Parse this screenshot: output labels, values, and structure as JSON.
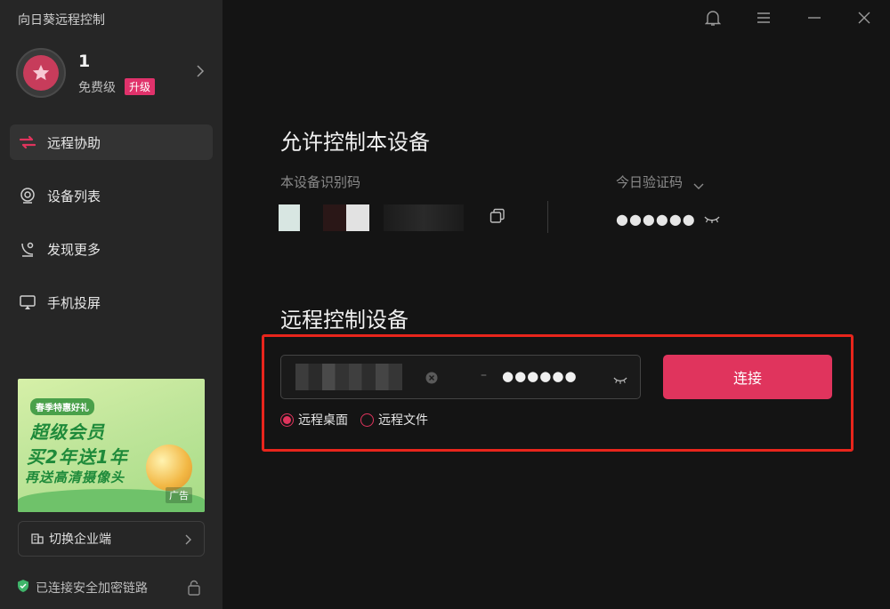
{
  "app": {
    "title": "向日葵远程控制"
  },
  "profile": {
    "name": "1",
    "level": "免费级",
    "upgrade": "升级"
  },
  "nav": {
    "items": [
      {
        "label": "远程协助",
        "icon": "remote-assist-icon",
        "active": true
      },
      {
        "label": "设备列表",
        "icon": "device-list-icon",
        "active": false
      },
      {
        "label": "发现更多",
        "icon": "discover-icon",
        "active": false
      },
      {
        "label": "手机投屏",
        "icon": "screen-cast-icon",
        "active": false
      }
    ]
  },
  "ad": {
    "tag_top": "春季特惠好礼",
    "line1": "超级会员",
    "line2": "买2年送1年",
    "line3": "再送高清摄像头",
    "badge": "广告"
  },
  "enterprise": {
    "label": "切换企业端"
  },
  "security": {
    "label": "已连接安全加密链路"
  },
  "allow_control": {
    "title": "允许控制本设备",
    "device_id_label": "本设备识别码",
    "code_label": "今日验证码",
    "code_value": "●●●●●●"
  },
  "remote_control": {
    "title": "远程控制设备",
    "separator": "–",
    "password_value": "●●●●●●",
    "connect_label": "连接",
    "modes": [
      {
        "label": "远程桌面",
        "selected": true
      },
      {
        "label": "远程文件",
        "selected": false
      }
    ]
  },
  "colors": {
    "accent": "#e0345d",
    "highlight_border": "#e8251c",
    "sidebar_bg": "#262626",
    "main_bg": "#141414"
  }
}
